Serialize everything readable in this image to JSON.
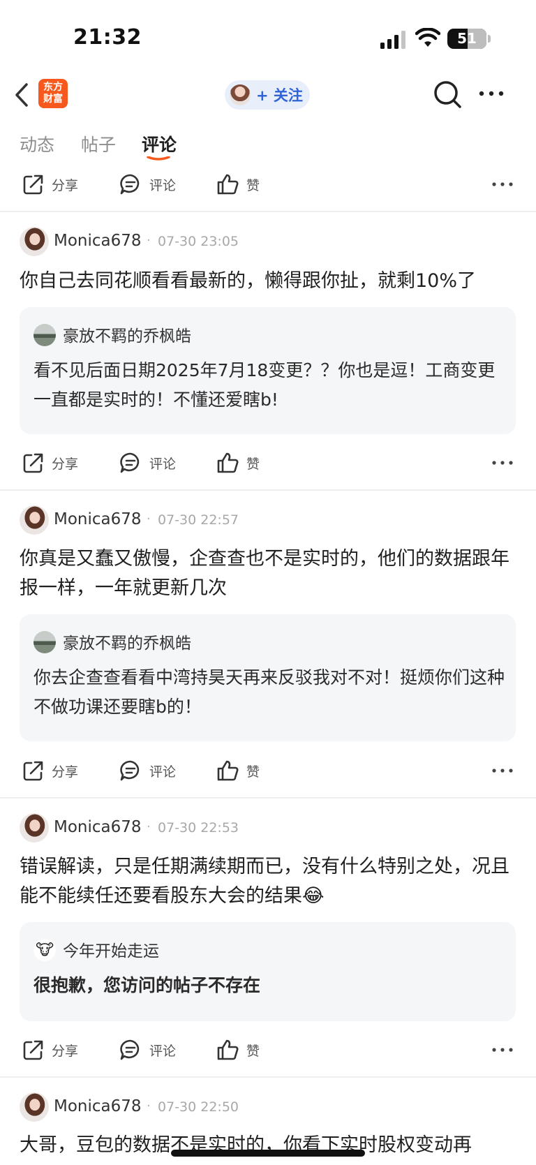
{
  "status_bar": {
    "time": "21:32",
    "battery": "51",
    "battery_level": 0.51
  },
  "nav": {
    "brand_logo_text": "东方财富",
    "follow_label": "+ 关注",
    "icons": {
      "back": "chevron-left-icon",
      "search": "search-icon",
      "more": "more-dots-icon"
    }
  },
  "tabs": [
    {
      "label": "动态",
      "active": false
    },
    {
      "label": "帖子",
      "active": false
    },
    {
      "label": "评论",
      "active": true
    }
  ],
  "actions": {
    "share_label": "分享",
    "comment_label": "评论",
    "like_label": "赞"
  },
  "colors": {
    "accent_orange": "#f7581d",
    "follow_blue": "#2e64d8",
    "card_bg": "#f5f6f8"
  },
  "comments": [
    {
      "user": "Monica678",
      "dot": "·",
      "time": "07-30 23:05",
      "text": "你自己去同花顺看看最新的，懒得跟你扯，就剩10%了",
      "quote": {
        "user": "豪放不羁的乔枫皓",
        "text": "看不见后面日期2025年7月18变更？？你也是逗！工商变更一直都是实时的！不懂还爱瞎b!"
      }
    },
    {
      "user": "Monica678",
      "dot": "·",
      "time": "07-30 22:57",
      "text": "你真是又蠢又傲慢，企查查也不是实时的，他们的数据跟年报一样，一年就更新几次",
      "quote": {
        "user": "豪放不羁的乔枫皓",
        "text": "你去企查查看看中湾持昊天再来反驳我对不对！挺烦你们这种不做功课还要瞎b的！"
      }
    },
    {
      "user": "Monica678",
      "dot": "·",
      "time": "07-30 22:53",
      "text": "错误解读，只是任期满续期而已，没有什么特别之处，况且能不能续任还要看股东大会的结果😂",
      "quote": {
        "user": "今年开始走运",
        "text": "很抱歉，您访问的帖子不存在"
      }
    },
    {
      "user": "Monica678",
      "dot": "·",
      "time": "07-30 22:50",
      "text": "大哥，豆包的数据不是实时的，你看下实时股权变动再"
    }
  ]
}
